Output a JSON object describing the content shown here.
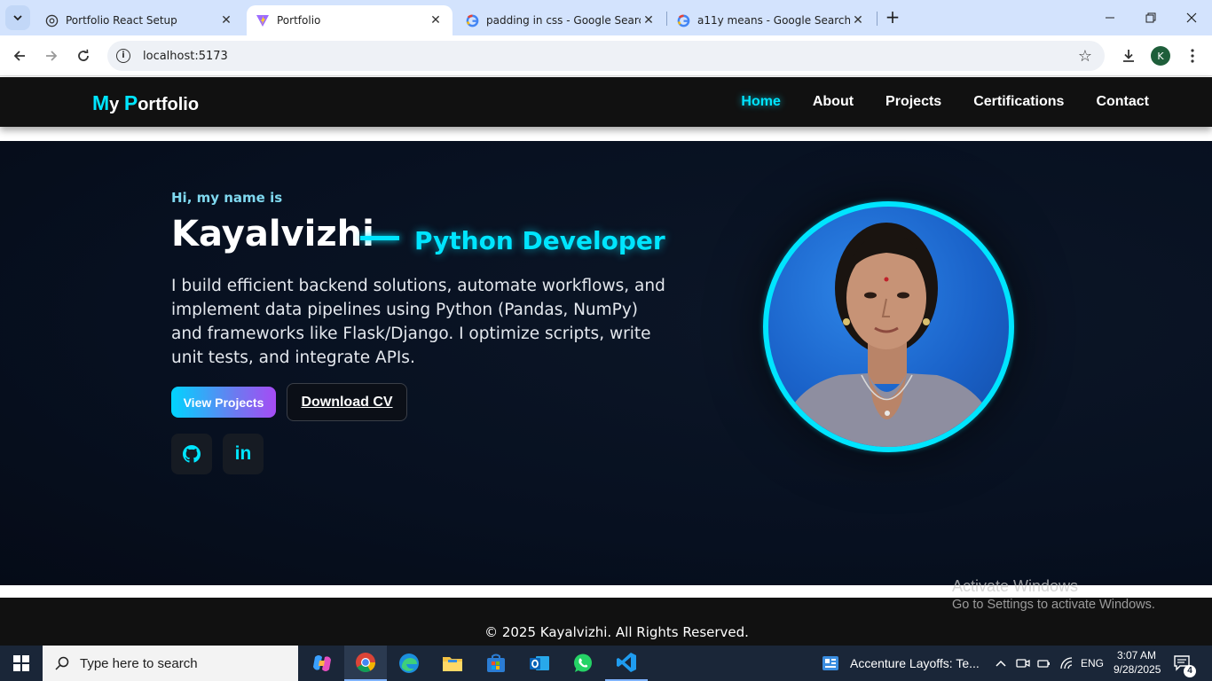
{
  "browser": {
    "tabs": [
      {
        "title": "Portfolio React Setup",
        "icon": "chatgpt-icon",
        "active": false
      },
      {
        "title": "Portfolio",
        "icon": "vite-icon",
        "active": true
      },
      {
        "title": "padding in css - Google Search",
        "icon": "google-icon",
        "active": false
      },
      {
        "title": "a11y means - Google Search",
        "icon": "google-icon",
        "active": false
      }
    ],
    "url": "localhost:5173",
    "profile_initial": "K"
  },
  "site": {
    "logo_first_m": "M",
    "logo_y": "y ",
    "logo_first_p": "P",
    "logo_rest": "ortfolio",
    "nav": [
      "Home",
      "About",
      "Projects",
      "Certifications",
      "Contact"
    ],
    "active_nav": "Home",
    "accent_color": "#00e5ff"
  },
  "hero": {
    "greeting": "Hi, my name is",
    "name": "Kayalvizhi",
    "role": "Python Developer",
    "bio": "I build efficient backend solutions, automate workflows, and implement data pipelines using Python (Pandas, NumPy) and frameworks like Flask/Django. I optimize scripts, write unit tests, and integrate APIs.",
    "primary_button": "View Projects",
    "secondary_button": "Download CV",
    "social": [
      "github-icon",
      "linkedin-icon"
    ],
    "linkedin_text": "in"
  },
  "footer": {
    "text": "© 2025 Kayalvizhi. All Rights Reserved."
  },
  "watermark": {
    "line1": "Activate Windows",
    "line2": "Go to Settings to activate Windows."
  },
  "taskbar": {
    "search_placeholder": "Type here to search",
    "news": "Accenture Layoffs: Te...",
    "language": "ENG",
    "time": "3:07 AM",
    "date": "9/28/2025",
    "notification_count": "4"
  }
}
